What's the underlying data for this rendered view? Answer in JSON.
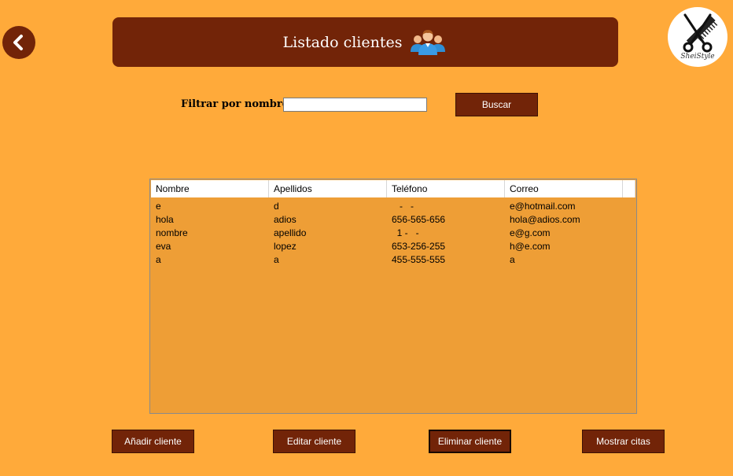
{
  "header": {
    "title": "Listado clientes",
    "back_icon": "chevron-left-icon",
    "people_icon": "users-group-icon",
    "logo_text": "SheiStyle",
    "logo_icon": "scissors-comb-icon"
  },
  "filter": {
    "label": "Filtrar por nombre:",
    "value": "",
    "button_label": "Buscar"
  },
  "table": {
    "columns": [
      "Nombre",
      "Apellidos",
      "Teléfono",
      "Correo"
    ],
    "rows": [
      [
        "e",
        "d",
        "   -   -",
        "e@hotmail.com"
      ],
      [
        "hola",
        "adios",
        "656-565-656",
        "hola@adios.com"
      ],
      [
        "nombre",
        "apellido",
        "  1 -   -",
        "e@g.com"
      ],
      [
        "eva",
        "lopez",
        "653-256-255",
        "h@e.com"
      ],
      [
        "a",
        "a",
        "455-555-555",
        "a"
      ]
    ]
  },
  "actions": {
    "add_label": "Añadir cliente",
    "edit_label": "Editar cliente",
    "delete_label": "Eliminar cliente",
    "show_label": "Mostrar citas"
  },
  "colors": {
    "background": "#FFAA3A",
    "primary": "#722408",
    "grid_background": "#EE9E36"
  }
}
